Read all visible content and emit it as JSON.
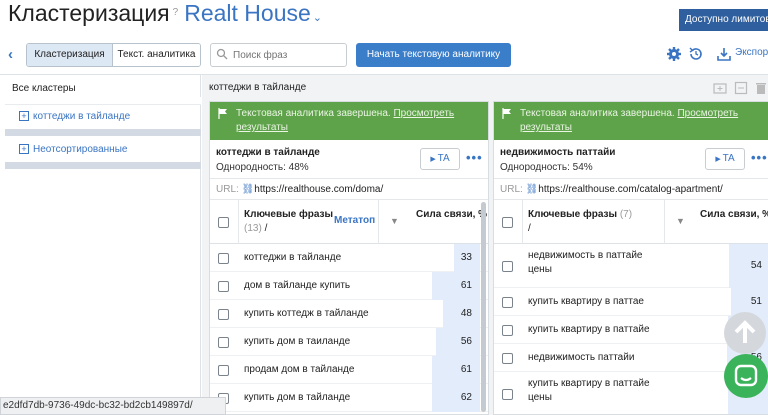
{
  "header": {
    "title": "Кластеризация",
    "help": "?",
    "project": "Realt House",
    "project_chevron": "chevron-down-icon",
    "limits_label": "Доступно лимитов:"
  },
  "toolbar": {
    "tabs": [
      {
        "label": "Кластеризация",
        "active": true
      },
      {
        "label": "Текст. аналитика",
        "active": false
      }
    ],
    "search_placeholder": "Поиск фраз",
    "start_label": "Начать текстовую аналитику",
    "export_label": "Экспорт",
    "icons": [
      "back-icon",
      "search-icon",
      "settings-gear-icon",
      "history-icon",
      "export-icon"
    ]
  },
  "sidebar": {
    "header": "Все кластеры",
    "items": [
      {
        "label": "коттеджи в тайланде"
      },
      {
        "label": "Неотсортированные"
      }
    ]
  },
  "breadcrumb": "коттеджи в тайланде",
  "clusters": [
    {
      "banner_text": "Текстовая аналитика завершена.",
      "banner_link": "Просмотреть результаты",
      "name": "коттеджи в тайланде",
      "uniformity": "Однородность: 48%",
      "ta_label": "TA",
      "url_label": "URL:",
      "url": "https://realthouse.com/doma/",
      "col_keywords": "Ключевые фразы",
      "col_count": "(13)",
      "col_slash": "/",
      "col_metatop": "Метатоп",
      "col_strength": "Сила связи, %",
      "rows": [
        {
          "keyword": "коттеджи в тайланде",
          "score": "33",
          "level": 0.33
        },
        {
          "keyword": "дом в тайланде купить",
          "score": "61",
          "level": 0.61
        },
        {
          "keyword": "купить коттедж в тайланде",
          "score": "48",
          "level": 0.48
        },
        {
          "keyword": "купить дом в таиланде",
          "score": "56",
          "level": 0.56
        },
        {
          "keyword": "продам дом в тайланде",
          "score": "61",
          "level": 0.61
        },
        {
          "keyword": "купить дом в тайланде",
          "score": "62",
          "level": 0.62
        }
      ]
    },
    {
      "banner_text": "Текстовая аналитика завершена.",
      "banner_link": "Просмотреть результаты",
      "name": "недвижимость паттайи",
      "uniformity": "Однородность: 54%",
      "ta_label": "TA",
      "url_label": "URL:",
      "url": "https://realthouse.com/catalog-apartment/",
      "col_keywords": "Ключевые фразы",
      "col_count": "(7)",
      "col_slash": "/",
      "col_metatop": "",
      "col_strength": "Сила связи, %",
      "rows": [
        {
          "keyword": "недвижимость в паттайе цены",
          "score": "54",
          "level": 0.54
        },
        {
          "keyword": "купить квартиру в паттае",
          "score": "51",
          "level": 0.51
        },
        {
          "keyword": "купить квартиру в паттайе",
          "score": "",
          "level": 0.55
        },
        {
          "keyword": "недвижимость паттайи",
          "score": "56",
          "level": 0.56
        },
        {
          "keyword": "купить квартиру в паттайе цены",
          "score": "",
          "level": 0.55
        }
      ]
    }
  ],
  "statusbar": "e2dfd7db-9736-49dc-bc32-bd2cb149897d/",
  "colors": {
    "accent": "#3a75c4",
    "primary_button": "#3a7dc9",
    "banner": "#5ea24a",
    "chat": "#3bb35a"
  }
}
